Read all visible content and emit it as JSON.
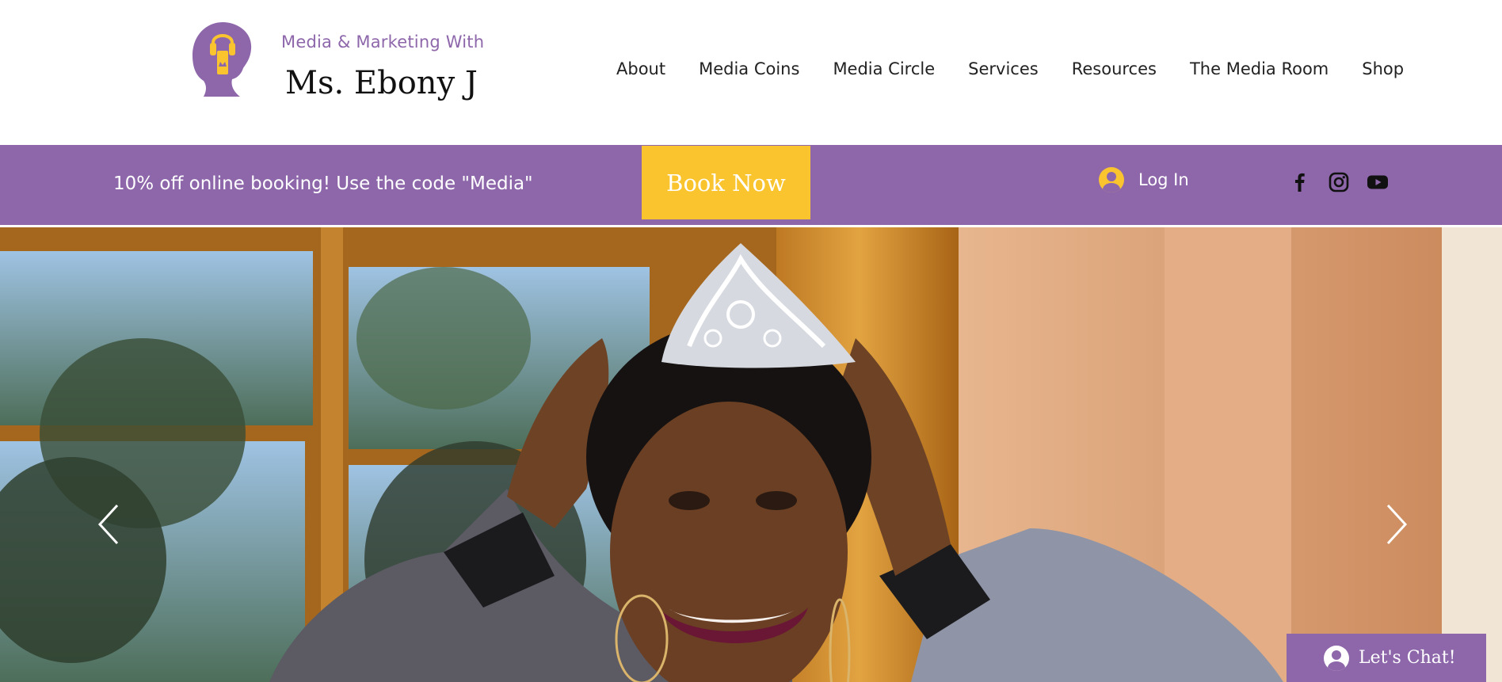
{
  "brand": {
    "subtitle": "Media & Marketing With",
    "name": "Ms. Ebony J",
    "logo_icon": "woman-silhouette-headphones-logo"
  },
  "nav": {
    "items": [
      {
        "label": "About"
      },
      {
        "label": "Media Coins"
      },
      {
        "label": "Media Circle"
      },
      {
        "label": "Services"
      },
      {
        "label": "Resources"
      },
      {
        "label": "The Media Room"
      },
      {
        "label": "Shop"
      }
    ]
  },
  "promo": {
    "text": "10% off online booking! Use the code \"Media\"",
    "book_label": "Book Now",
    "login_label": "Log In",
    "social": [
      "facebook-icon",
      "instagram-icon",
      "youtube-icon"
    ]
  },
  "hero": {
    "image": "woman-wearing-crown-photo",
    "prev_icon": "chevron-left-icon",
    "next_icon": "chevron-right-icon"
  },
  "chat": {
    "label": "Let's Chat!"
  },
  "colors": {
    "brand_purple": "#8e67ab",
    "accent_yellow": "#fac42f",
    "white": "#ffffff"
  }
}
